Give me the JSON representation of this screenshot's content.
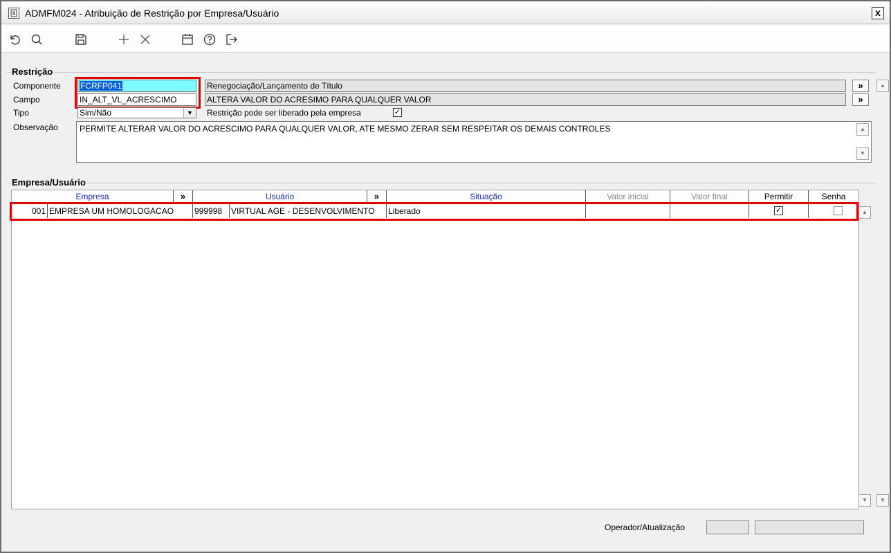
{
  "window": {
    "title": "ADMFM024 - Atribuição de Restrição por Empresa/Usuário",
    "close_label": "x"
  },
  "toolbar": {
    "buttons": [
      "undo-icon",
      "search-icon",
      "save-icon",
      "add-icon",
      "delete-icon",
      "calendar-icon",
      "help-icon",
      "exit-icon"
    ]
  },
  "restricao": {
    "group_label": "Restrição",
    "componente_label": "Componente",
    "componente_code": "FCRFP041",
    "componente_desc": "Renegociação/Lançamento de Título",
    "campo_label": "Campo",
    "campo_code": "IN_ALT_VL_ACRESCIMO",
    "campo_desc": "ALTERA VALOR DO ACRESIMO PARA QUALQUER VALOR",
    "tipo_label": "Tipo",
    "tipo_value": "Sim/Não",
    "liberado_label": "Restrição pode ser liberado pela empresa",
    "liberado_checked": true,
    "observacao_label": "Observação",
    "observacao_value": "PERMITE ALTERAR VALOR DO ACRESCIMO PARA QUALQUER VALOR, ATE MESMO ZERAR SEM RESPEITAR OS DEMAIS CONTROLES",
    "arrow_label": "»"
  },
  "empresa_usuario": {
    "group_label": "Empresa/Usuário",
    "columns": {
      "empresa": "Empresa",
      "arrow1": "»",
      "usuario": "Usuário",
      "arrow2": "»",
      "situacao": "Situação",
      "valor_inicial": "Valor inicial",
      "valor_final": "Valor final",
      "permitir": "Permitir",
      "senha": "Senha"
    },
    "rows": [
      {
        "empresa_code": "001",
        "empresa_name": "EMPRESA UM HOMOLOGACAO",
        "usuario_code": "999998",
        "usuario_name": "VIRTUAL AGE - DESENVOLVIMENTO",
        "situacao": "Liberado",
        "valor_inicial": "",
        "valor_final": "",
        "permitir": true,
        "senha": false
      }
    ]
  },
  "footer": {
    "operador_label": "Operador/Atualização"
  },
  "colors": {
    "highlight": "#e00000",
    "selected_field": "#7ffcff",
    "selection": "#0a5fd8",
    "header_blue": "#1a2dae"
  }
}
